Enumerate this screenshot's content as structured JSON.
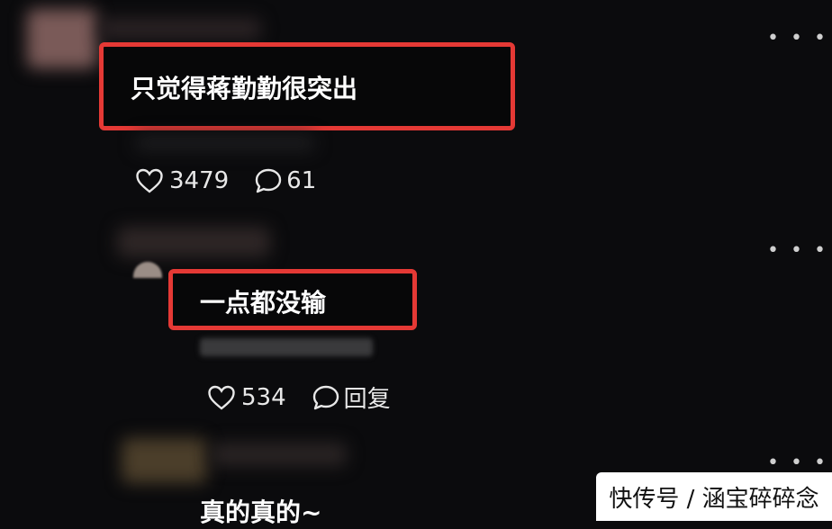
{
  "comments": [
    {
      "text": "只觉得蒋勤勤很突出",
      "likes": "3479",
      "replies": "61",
      "more_icon": "ellipsis-icon"
    },
    {
      "text": "一点都没输",
      "likes": "534",
      "reply_label": "回复",
      "more_icon": "ellipsis-icon"
    },
    {
      "text": "真的真的~",
      "more_icon": "ellipsis-icon"
    }
  ],
  "highlight_color": "#e53935",
  "watermark": "快传号 / 涵宝碎碎念"
}
